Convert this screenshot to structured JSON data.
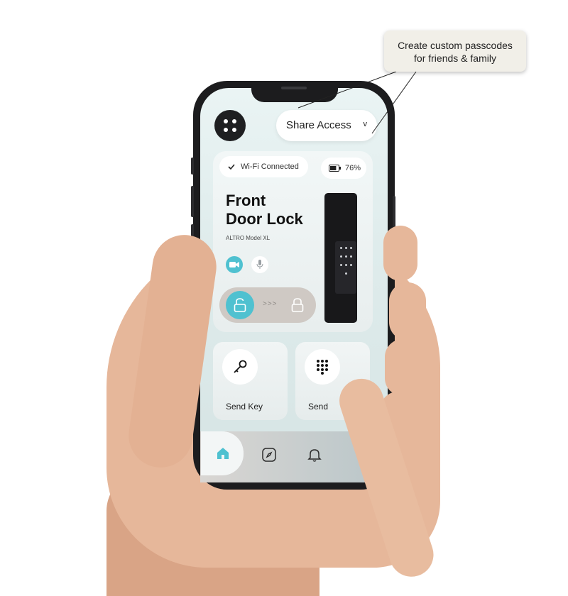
{
  "header": {
    "share_label": "Share Access",
    "share_chevron": "v"
  },
  "callout": {
    "line1": "Create custom passcodes",
    "line2": "for friends & family"
  },
  "status": {
    "wifi_label": "Wi-Fi Connected",
    "battery_label": "76%",
    "battery_level": 0.76
  },
  "device": {
    "title_line1": "Front",
    "title_line2": "Door Lock",
    "model": "ALTRO Model XL"
  },
  "slider": {
    "arrows": ">>>"
  },
  "actions": {
    "send_key_label": "Send Key",
    "send_code_label": "Send"
  },
  "icons": {
    "menu": "menu-dots-icon",
    "check": "check-icon",
    "battery": "battery-icon",
    "camera": "camera-icon",
    "mic": "microphone-icon",
    "unlock": "unlock-icon",
    "lock": "lock-icon",
    "key": "key-icon",
    "keypad": "keypad-icon",
    "home": "home-icon",
    "compass": "compass-icon",
    "bell": "bell-icon"
  },
  "colors": {
    "accent": "#4fc1d0",
    "dark": "#1e1f21"
  }
}
